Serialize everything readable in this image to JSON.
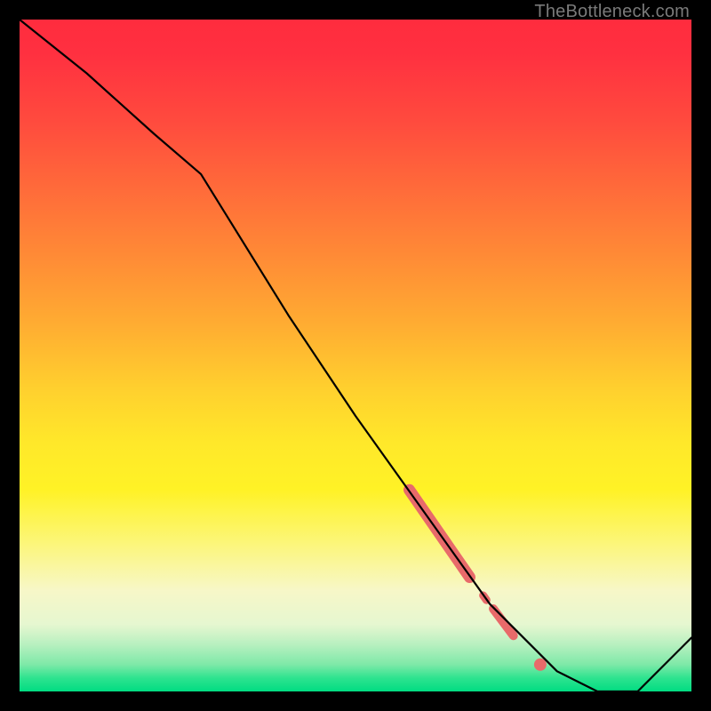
{
  "watermark": "TheBottleneck.com",
  "colors": {
    "line": "#000000",
    "marker": "#e86a6a",
    "background": "#000000"
  },
  "chart_data": {
    "type": "line",
    "title": "",
    "xlabel": "",
    "ylabel": "",
    "xlim": [
      0,
      100
    ],
    "ylim": [
      0,
      100
    ],
    "grid": false,
    "legend": false,
    "series": [
      {
        "name": "curve",
        "x": [
          0,
          10,
          20,
          27,
          40,
          50,
          60,
          70,
          80,
          86,
          92,
          100
        ],
        "y": [
          100,
          92,
          83,
          77,
          56,
          41,
          27,
          13,
          3,
          0,
          0,
          8
        ]
      }
    ],
    "highlight_segments": [
      {
        "x0": 58,
        "y0": 30,
        "x1": 67,
        "y1": 17,
        "width": 13
      },
      {
        "x0": 70.5,
        "y0": 12.3,
        "x1": 73.5,
        "y1": 8.3,
        "width": 10
      },
      {
        "x0": 69.0,
        "y0": 14.3,
        "x1": 69.5,
        "y1": 13.6,
        "width": 9
      }
    ],
    "highlight_points": [
      {
        "x": 77.5,
        "y": 4.0,
        "r": 7
      }
    ]
  }
}
